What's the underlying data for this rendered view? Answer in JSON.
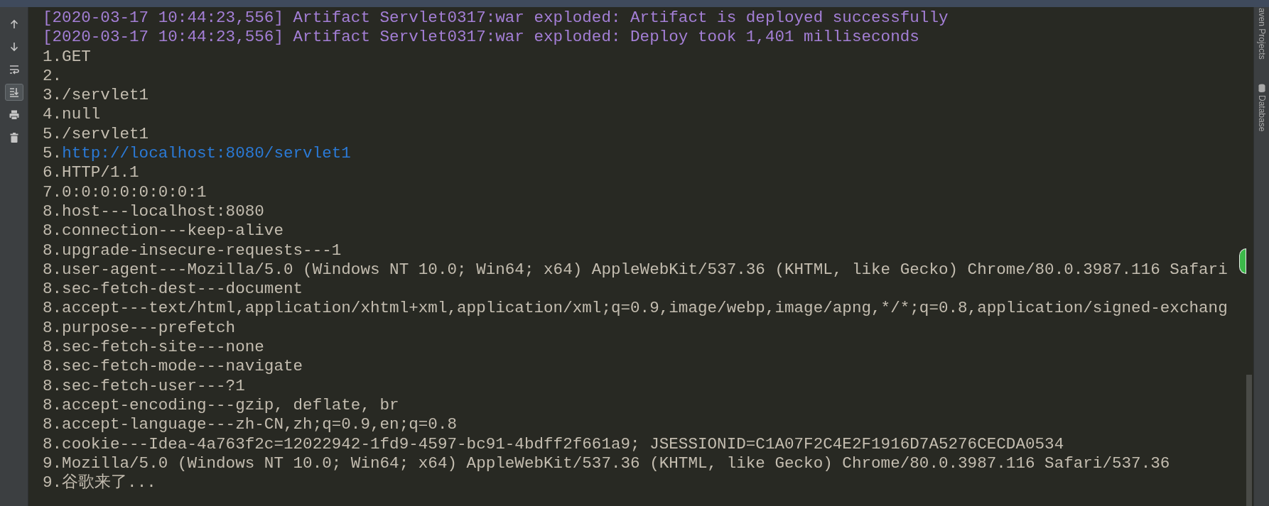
{
  "toolbar": [
    {
      "kind": "up",
      "selected": false
    },
    {
      "kind": "down",
      "selected": false
    },
    {
      "kind": "wrap",
      "selected": false
    },
    {
      "kind": "scroll_end",
      "selected": true
    },
    {
      "kind": "print",
      "selected": false
    },
    {
      "kind": "trash",
      "selected": false
    }
  ],
  "console": {
    "lines": [
      {
        "kind": "log",
        "text": "[2020-03-17 10:44:23,556] Artifact Servlet0317:war exploded: Artifact is deployed successfully"
      },
      {
        "kind": "log",
        "text": "[2020-03-17 10:44:23,556] Artifact Servlet0317:war exploded: Deploy took 1,401 milliseconds"
      },
      {
        "kind": "text",
        "text": "1.GET"
      },
      {
        "kind": "text",
        "text": "2."
      },
      {
        "kind": "text",
        "text": "3./servlet1"
      },
      {
        "kind": "text",
        "text": "4.null"
      },
      {
        "kind": "text",
        "text": "5./servlet1"
      },
      {
        "kind": "link",
        "prefix": "5.",
        "url": "http://localhost:8080/servlet1"
      },
      {
        "kind": "text",
        "text": "6.HTTP/1.1"
      },
      {
        "kind": "text",
        "text": "7.0:0:0:0:0:0:0:1"
      },
      {
        "kind": "text",
        "text": "8.host---localhost:8080"
      },
      {
        "kind": "text",
        "text": "8.connection---keep-alive"
      },
      {
        "kind": "text",
        "text": "8.upgrade-insecure-requests---1"
      },
      {
        "kind": "text",
        "text": "8.user-agent---Mozilla/5.0 (Windows NT 10.0; Win64; x64) AppleWebKit/537.36 (KHTML, like Gecko) Chrome/80.0.3987.116 Safari"
      },
      {
        "kind": "text",
        "text": "8.sec-fetch-dest---document"
      },
      {
        "kind": "text",
        "text": "8.accept---text/html,application/xhtml+xml,application/xml;q=0.9,image/webp,image/apng,*/*;q=0.8,application/signed-exchang"
      },
      {
        "kind": "text",
        "text": "8.purpose---prefetch"
      },
      {
        "kind": "text",
        "text": "8.sec-fetch-site---none"
      },
      {
        "kind": "text",
        "text": "8.sec-fetch-mode---navigate"
      },
      {
        "kind": "text",
        "text": "8.sec-fetch-user---?1"
      },
      {
        "kind": "text",
        "text": "8.accept-encoding---gzip, deflate, br"
      },
      {
        "kind": "text",
        "text": "8.accept-language---zh-CN,zh;q=0.9,en;q=0.8"
      },
      {
        "kind": "text",
        "text": "8.cookie---Idea-4a763f2c=12022942-1fd9-4597-bc91-4bdff2f661a9; JSESSIONID=C1A07F2C4E2F1916D7A5276CECDA0534"
      },
      {
        "kind": "text",
        "text": "9.Mozilla/5.0 (Windows NT 10.0; Win64; x64) AppleWebKit/537.36 (KHTML, like Gecko) Chrome/80.0.3987.116 Safari/537.36"
      },
      {
        "kind": "text",
        "text": "9.谷歌来了..."
      }
    ]
  },
  "side_panel": {
    "tabs": [
      {
        "kind": "plain",
        "label": "aven Projects"
      },
      {
        "kind": "database",
        "label": "Database"
      }
    ]
  }
}
